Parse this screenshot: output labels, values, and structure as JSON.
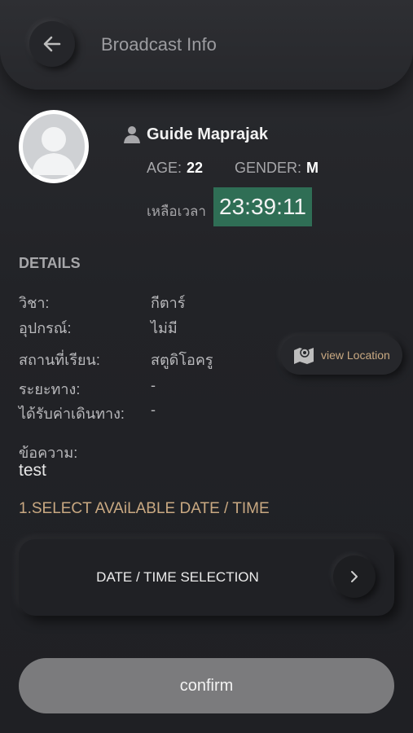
{
  "header": {
    "title": "Broadcast Info"
  },
  "profile": {
    "name": "Guide Maprajak",
    "age_label": "AGE:",
    "age": "22",
    "gender_label": "GENDER:",
    "gender": "M",
    "remaining_label": "เหลือเวลา",
    "countdown": "23:39:11",
    "countdown_color": "#2f6e55"
  },
  "details": {
    "title": "DETAILS",
    "subject_label": "วิชา:",
    "subject_value": "กีตาร์",
    "equipment_label": "อุปกรณ์:",
    "equipment_value": "ไม่มี",
    "place_label": "สถานที่เรียน:",
    "place_value": "สตูดิโอครู",
    "view_location": "view Location",
    "distance_label": "ระยะทาง:",
    "distance_value": "-",
    "travel_label": "ได้รับค่าเดินทาง:",
    "travel_value": "-",
    "message_label": "ข้อความ:",
    "message_value": "test"
  },
  "schedule": {
    "title": "1.SELECT AVAiLABLE DATE / TIME",
    "selection_label": "DATE / TIME SELECTION"
  },
  "confirm_label": "confirm",
  "colors": {
    "accent": "#c9a982"
  }
}
